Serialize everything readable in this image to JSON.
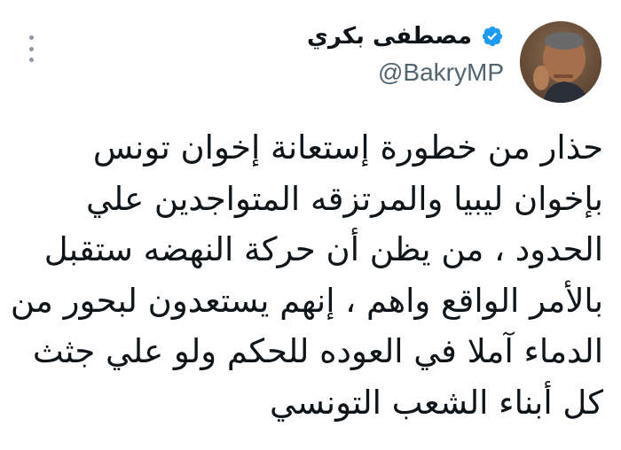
{
  "tweet": {
    "author_name": "مصطفى بكري",
    "handle": "@BakryMP",
    "verified_icon": "verified-badge-icon",
    "more_icon": "vertical-ellipsis-icon",
    "text": "حذار من خطورة إستعانة إخوان تونس\nبإخوان ليبيا والمرتزقه المتواجدين علي\nالحدود ، من يظن أن حركة النهضه ستقبل\nبالأمر الواقع واهم ، إنهم يستعدون لبحور من\nالدماء آملا في العوده للحكم ولو علي جثث\nكل أبناء الشعب التونسي"
  },
  "colors": {
    "verified": "#1d9bf0",
    "text": "#0f1419",
    "secondary": "#536471"
  }
}
